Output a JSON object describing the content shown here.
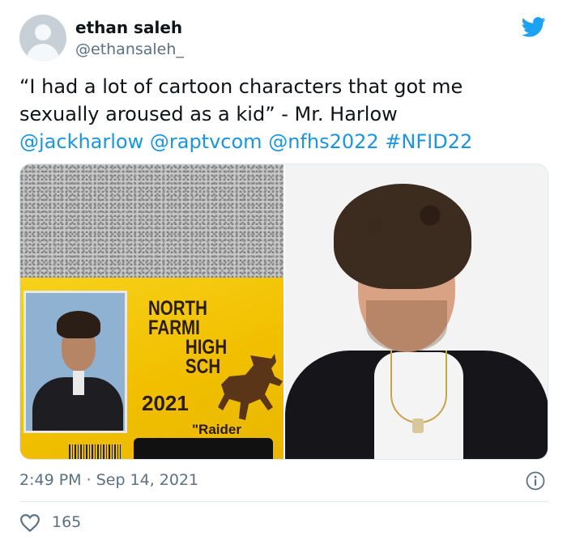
{
  "author": {
    "name": "ethan saleh",
    "handle": "@ethansaleh_"
  },
  "tweet": {
    "line1": "“I had a lot of cartoon characters that got me",
    "line2": "sexually aroused as a kid” - Mr. Harlow",
    "tags": [
      "@jackharlow",
      "@raptvcom",
      "@nfhs2022",
      "#NFID22"
    ],
    "link_color": "#1b95e0"
  },
  "media": {
    "left_photo": {
      "school_line1": "NORTH FARMI",
      "school_line2": "HIGH SCH",
      "year": "2021",
      "mascot": "\"Raider"
    }
  },
  "meta": {
    "time": "2:49 PM",
    "separator": " · ",
    "date": "Sep 14, 2021"
  },
  "engagement": {
    "likes": "165"
  },
  "icons": {
    "brand": "twitter-bird-icon",
    "info": "info-icon",
    "like": "heart-icon"
  },
  "colors": {
    "brand_blue": "#1da1f2",
    "secondary_text": "#5b7083"
  }
}
